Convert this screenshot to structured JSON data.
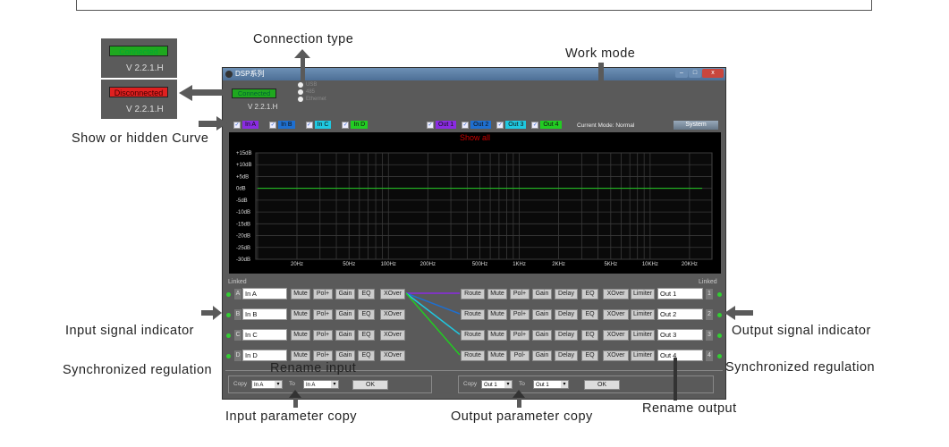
{
  "annotations": {
    "connection_type": "Connection type",
    "work_mode": "Work mode",
    "show_hidden": "Show or  hidden Curve",
    "input_indicator": "Input signal indicator",
    "sync_left": "Synchronized regulation",
    "rename_input": "Rename input",
    "input_copy": "Input parameter copy",
    "output_copy": "Output parameter copy",
    "rename_output": "Rename output",
    "output_indicator": "Output signal indicator",
    "sync_right": "Synchronized regulation"
  },
  "thumbs": {
    "connected": "Connected",
    "disconnected": "Disconnected",
    "version": "V 2.2.1.H"
  },
  "window": {
    "title": "DSP系列",
    "status": "Connected",
    "version": "V 2.2.1.H",
    "connection_options": [
      "USB",
      "485",
      "Ethernet"
    ],
    "selected_connection": "USB",
    "mode": "Current Mode: Normal",
    "system_button": "System",
    "graph_title": "Show all",
    "linked_left": "Linked",
    "linked_right": "Linked"
  },
  "curve_toggles": {
    "inputs": [
      {
        "label": "In A",
        "color": "#8a2be2"
      },
      {
        "label": "In B",
        "color": "#1e6fd0"
      },
      {
        "label": "In C",
        "color": "#1fc8e0"
      },
      {
        "label": "In D",
        "color": "#22cc22"
      }
    ],
    "outputs": [
      {
        "label": "Out 1",
        "color": "#8a2be2"
      },
      {
        "label": "Out 2",
        "color": "#1e6fd0"
      },
      {
        "label": "Out 3",
        "color": "#1fc8e0"
      },
      {
        "label": "Out 4",
        "color": "#22cc22"
      }
    ]
  },
  "chart_data": {
    "type": "line",
    "x_ticks": [
      "20Hz",
      "50Hz",
      "100Hz",
      "200Hz",
      "500Hz",
      "1KHz",
      "2KHz",
      "5KHz",
      "10KHz",
      "20KHz"
    ],
    "y_ticks": [
      "+15dB",
      "+10dB",
      "+5dB",
      "0dB",
      "-5dB",
      "-10dB",
      "-15dB",
      "-20dB",
      "-25dB",
      "-30dB"
    ],
    "ylim": [
      -30,
      15
    ],
    "xscale": "log",
    "series": [
      {
        "x": [
          10,
          25000
        ],
        "y": [
          0,
          0
        ],
        "color": "#22cc22"
      }
    ]
  },
  "inputs": [
    {
      "letter": "A",
      "name": "In A",
      "buttons": [
        "Mute",
        "Pol+",
        "Gain",
        "EQ",
        "XOver"
      ]
    },
    {
      "letter": "B",
      "name": "In B",
      "buttons": [
        "Mute",
        "Pol+",
        "Gain",
        "EQ",
        "XOver"
      ]
    },
    {
      "letter": "C",
      "name": "In C",
      "buttons": [
        "Mute",
        "Pol+",
        "Gain",
        "EQ",
        "XOver"
      ]
    },
    {
      "letter": "D",
      "name": "In D",
      "buttons": [
        "Mute",
        "Pol+",
        "Gain",
        "EQ",
        "XOver"
      ]
    }
  ],
  "outputs": [
    {
      "number": "1",
      "name": "Out 1",
      "buttons": [
        "Route",
        "Mute",
        "Pol+",
        "Gain",
        "Delay",
        "EQ",
        "XOver",
        "Limiter"
      ]
    },
    {
      "number": "2",
      "name": "Out 2",
      "buttons": [
        "Route",
        "Mute",
        "Pol+",
        "Gain",
        "Delay",
        "EQ",
        "XOver",
        "Limiter"
      ]
    },
    {
      "number": "3",
      "name": "Out 3",
      "buttons": [
        "Route",
        "Mute",
        "Pol+",
        "Gain",
        "Delay",
        "EQ",
        "XOver",
        "Limiter"
      ]
    },
    {
      "number": "4",
      "name": "Out 4",
      "buttons": [
        "Route",
        "Mute",
        "Pol-",
        "Gain",
        "Delay",
        "EQ",
        "XOver",
        "Limiter"
      ]
    }
  ],
  "copy_in": {
    "copy": "Copy",
    "from": "In A",
    "to": "To",
    "target": "In A",
    "ok": "OK"
  },
  "copy_out": {
    "copy": "Copy",
    "from": "Out 1",
    "to": "To",
    "target": "Out 1",
    "ok": "OK"
  }
}
